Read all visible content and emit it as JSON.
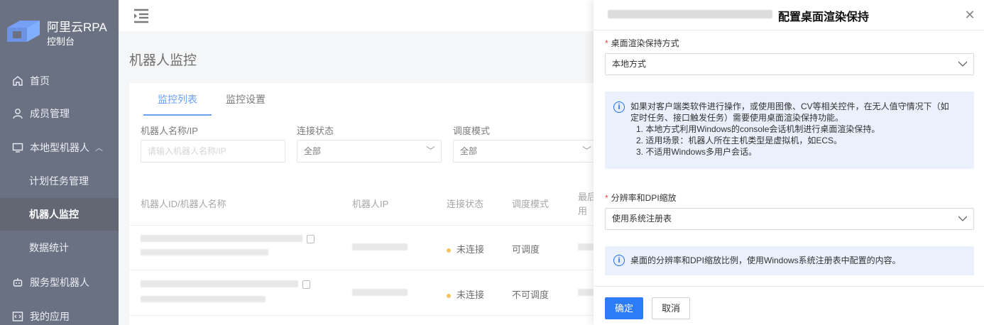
{
  "sidebar": {
    "logo_title": "阿里云RPA",
    "logo_sub": "控制台",
    "items": [
      {
        "label": "首页",
        "icon": "home-icon"
      },
      {
        "label": "成员管理",
        "icon": "user-icon"
      },
      {
        "label": "本地型机器人",
        "icon": "monitor-icon",
        "expanded": true
      },
      {
        "label": "计划任务管理"
      },
      {
        "label": "机器人监控",
        "active": true
      },
      {
        "label": "数据统计"
      },
      {
        "label": "服务型机器人",
        "icon": "robot-icon"
      },
      {
        "label": "我的应用",
        "icon": "code-icon"
      }
    ]
  },
  "main": {
    "page_title": "机器人监控",
    "tabs": [
      {
        "label": "监控列表",
        "active": true
      },
      {
        "label": "监控设置"
      }
    ],
    "filters": {
      "name_label": "机器人名称/IP",
      "name_placeholder": "请输入机器人名称/IP",
      "conn_label": "连接状态",
      "conn_value": "全部",
      "mode_label": "调度模式",
      "mode_value": "全部"
    },
    "table": {
      "headers": [
        "机器人ID/机器人名称",
        "机器人IP",
        "连接状态",
        "调度模式",
        "最后",
        "用"
      ],
      "rows": [
        {
          "status": "未连接",
          "mode": "可调度"
        },
        {
          "status": "未连接",
          "mode": "不可调度"
        }
      ]
    }
  },
  "drawer": {
    "title": "配置桌面渲染保持",
    "field1_label": "桌面渲染保持方式",
    "field1_value": "本地方式",
    "info1": {
      "line1": "如果对客户端类软件进行操作，或使用图像、CV等相关控件，在无人值守情况下（如",
      "line2": "定时任务、接口触发任务）需要使用桌面渲染保持功能。",
      "line3": "1. 本地方式利用Windows的console会话机制进行桌面渲染保持。",
      "line4": "2. 适用场景：机器人所在主机类型是虚拟机，如ECS。",
      "line5": "3. 不适用Windows多用户会话。"
    },
    "field2_label": "分辨率和DPI缩放",
    "field2_value": "使用系统注册表",
    "info2": "桌面的分辨率和DPI缩放比例，使用Windows系统注册表中配置的内容。",
    "confirm_label": "确定",
    "cancel_label": "取消",
    "required_mark": "*"
  },
  "colors": {
    "sidebar_bg": "#1b2540",
    "primary": "#2b7cf6",
    "info_bg": "#eaf1fd",
    "status_dot": "#f0a800"
  }
}
